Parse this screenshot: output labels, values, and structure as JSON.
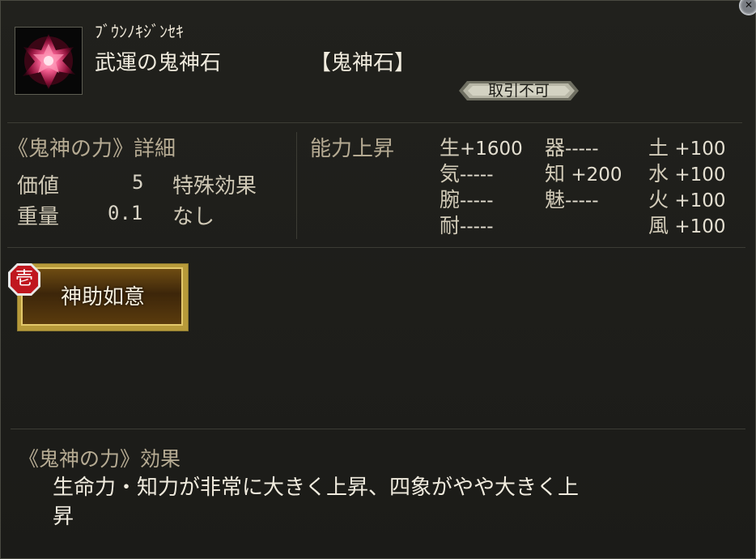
{
  "item": {
    "furigana": "ﾌﾞｳﾝﾉｷｼﾞﾝｾｷ",
    "name": "武運の鬼神石",
    "category": "【鬼神石】",
    "trade_status": "取引不可",
    "icon": "crimson-gem-icon"
  },
  "details": {
    "title": "《鬼神の力》詳細",
    "value_label": "価値",
    "value": "5",
    "weight_label": "重量",
    "weight": "0.1",
    "special_label": "特殊効果",
    "special_value": "なし"
  },
  "abilities": {
    "title": "能力上昇",
    "col1": [
      {
        "label": "生",
        "value": "+1600"
      },
      {
        "label": "気",
        "value": "-----"
      },
      {
        "label": "腕",
        "value": "-----"
      },
      {
        "label": "耐",
        "value": "-----"
      }
    ],
    "col2": [
      {
        "label": "器",
        "value": "-----"
      },
      {
        "label": "知",
        "value": " +200"
      },
      {
        "label": "魅",
        "value": "-----"
      }
    ],
    "col3": [
      {
        "label": "土",
        "value": " +100"
      },
      {
        "label": "水",
        "value": " +100"
      },
      {
        "label": "火",
        "value": " +100"
      },
      {
        "label": "風",
        "value": " +100"
      }
    ]
  },
  "skill": {
    "badge": "壱",
    "name": "神助如意"
  },
  "effect": {
    "title": "《鬼神の力》効果",
    "line1": "生命力・知力が非常に大きく上昇、四象がやや大きく上",
    "line2": "昇"
  },
  "colors": {
    "accent_gold": "#e3c86b",
    "badge_red": "#c0171f",
    "gem_pink": "#e8437a"
  }
}
